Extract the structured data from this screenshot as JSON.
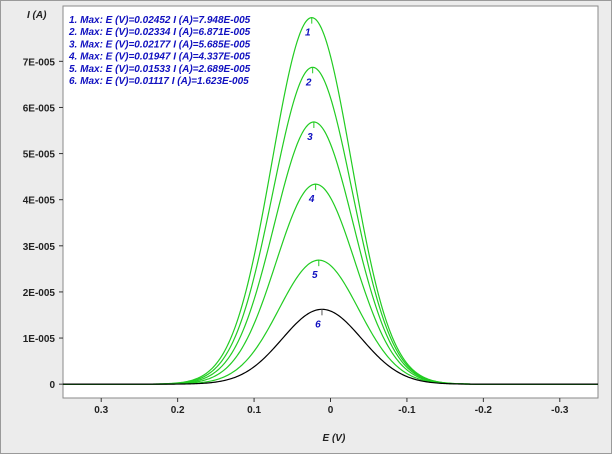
{
  "chart_data": {
    "type": "line",
    "xlabel": "E (V)",
    "ylabel": "I (A)",
    "xlim": [
      0.35,
      -0.35
    ],
    "ylim": [
      -3e-06,
      8.2e-05
    ],
    "x_ticks": [
      0.3,
      0.2,
      0.1,
      0,
      -0.1,
      -0.2,
      -0.3
    ],
    "x_tick_labels": [
      "0.3",
      "0.2",
      "0.1",
      "0",
      "-0.1",
      "-0.2",
      "-0.3"
    ],
    "y_ticks": [
      0,
      1e-05,
      2e-05,
      3e-05,
      4e-05,
      5e-05,
      6e-05,
      7e-05
    ],
    "y_tick_labels": [
      "0",
      "1E-005",
      "2E-005",
      "3E-005",
      "4E-005",
      "5E-005",
      "6E-005",
      "7E-005"
    ],
    "peak_width_sigma_V": 0.052,
    "legend": [
      "1. Max: E (V)=0.02452  I (A)=7.948E-005",
      "2. Max: E (V)=0.02334  I (A)=6.871E-005",
      "3. Max: E (V)=0.02177  I (A)=5.685E-005",
      "4. Max: E (V)=0.01947  I (A)=4.337E-005",
      "5. Max: E (V)=0.01533  I (A)=2.689E-005",
      "6. Max: E (V)=0.01117  I (A)=1.623E-005"
    ],
    "series": [
      {
        "label": "1",
        "peak_E": 0.02452,
        "peak_I": 7.948e-05,
        "color": "#22cc22"
      },
      {
        "label": "2",
        "peak_E": 0.02334,
        "peak_I": 6.871e-05,
        "color": "#22cc22"
      },
      {
        "label": "3",
        "peak_E": 0.02177,
        "peak_I": 5.685e-05,
        "color": "#22cc22"
      },
      {
        "label": "4",
        "peak_E": 0.01947,
        "peak_I": 4.337e-05,
        "color": "#22cc22"
      },
      {
        "label": "5",
        "peak_E": 0.01533,
        "peak_I": 2.689e-05,
        "color": "#22cc22"
      },
      {
        "label": "6",
        "peak_E": 0.01117,
        "peak_I": 1.623e-05,
        "color": "#000000"
      }
    ],
    "grid": false,
    "legend_position": "top-left"
  }
}
